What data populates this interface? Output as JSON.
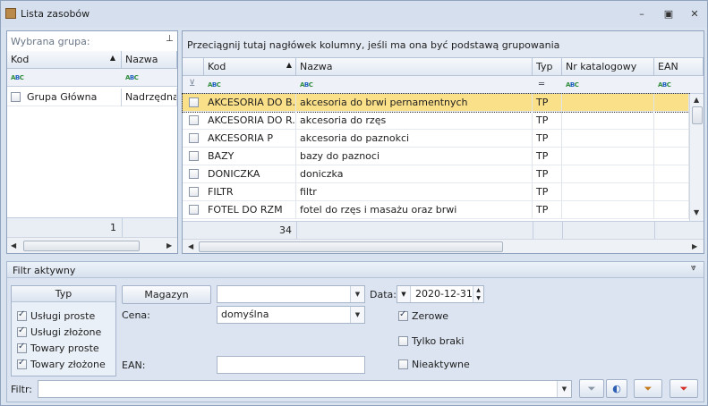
{
  "window": {
    "title": "Lista zasobów"
  },
  "left_panel": {
    "header": "Wybrana grupa:",
    "columns": [
      "Kod",
      "Nazwa"
    ],
    "rows": [
      {
        "kod": "Grupa Główna",
        "nazwa": "Nadrzędna G"
      }
    ],
    "footer_count": "1"
  },
  "main_grid": {
    "group_hint": "Przeciągnij tutaj nagłówek kolumny, jeśli ma ona być podstawą grupowania",
    "columns": [
      "Kod",
      "Nazwa",
      "Typ",
      "Nr katalogowy",
      "EAN"
    ],
    "rows": [
      {
        "kod": "AKCESORIA DO B...",
        "nazwa": "akcesoria do brwi pernamentnych",
        "typ": "TP"
      },
      {
        "kod": "AKCESORIA DO R...",
        "nazwa": "akcesoria do rzęs",
        "typ": "TP"
      },
      {
        "kod": "AKCESORIA P",
        "nazwa": "akcesoria do paznokci",
        "typ": "TP"
      },
      {
        "kod": "BAZY",
        "nazwa": "bazy do paznoci",
        "typ": "TP"
      },
      {
        "kod": "DONICZKA",
        "nazwa": "doniczka",
        "typ": "TP"
      },
      {
        "kod": "FILTR",
        "nazwa": "filtr",
        "typ": "TP"
      },
      {
        "kod": "FOTEL DO RZM",
        "nazwa": "fotel do rzęs i masażu oraz brwi",
        "typ": "TP"
      }
    ],
    "footer_count": "34"
  },
  "filter": {
    "title": "Filtr aktywny",
    "typ_group": {
      "label": "Typ",
      "items": [
        {
          "label": "Usługi proste",
          "checked": true
        },
        {
          "label": "Usługi złożone",
          "checked": true
        },
        {
          "label": "Towary proste",
          "checked": true
        },
        {
          "label": "Towary złożone",
          "checked": true
        }
      ]
    },
    "magazyn_label": "Magazyn",
    "magazyn_value": "",
    "cena_label": "Cena:",
    "cena_value": "domyślna",
    "ean_label": "EAN:",
    "ean_value": "",
    "data_label": "Data:",
    "data_value": "2020-12-31",
    "zerowe_label": "Zerowe",
    "tylko_braki_label": "Tylko braki",
    "nieaktywne_label": "Nieaktywne",
    "filtr_label": "Filtr:",
    "filtr_value": ""
  },
  "colors": {
    "selected_row": "#fbe08a",
    "accent": "#d6e0ee"
  }
}
